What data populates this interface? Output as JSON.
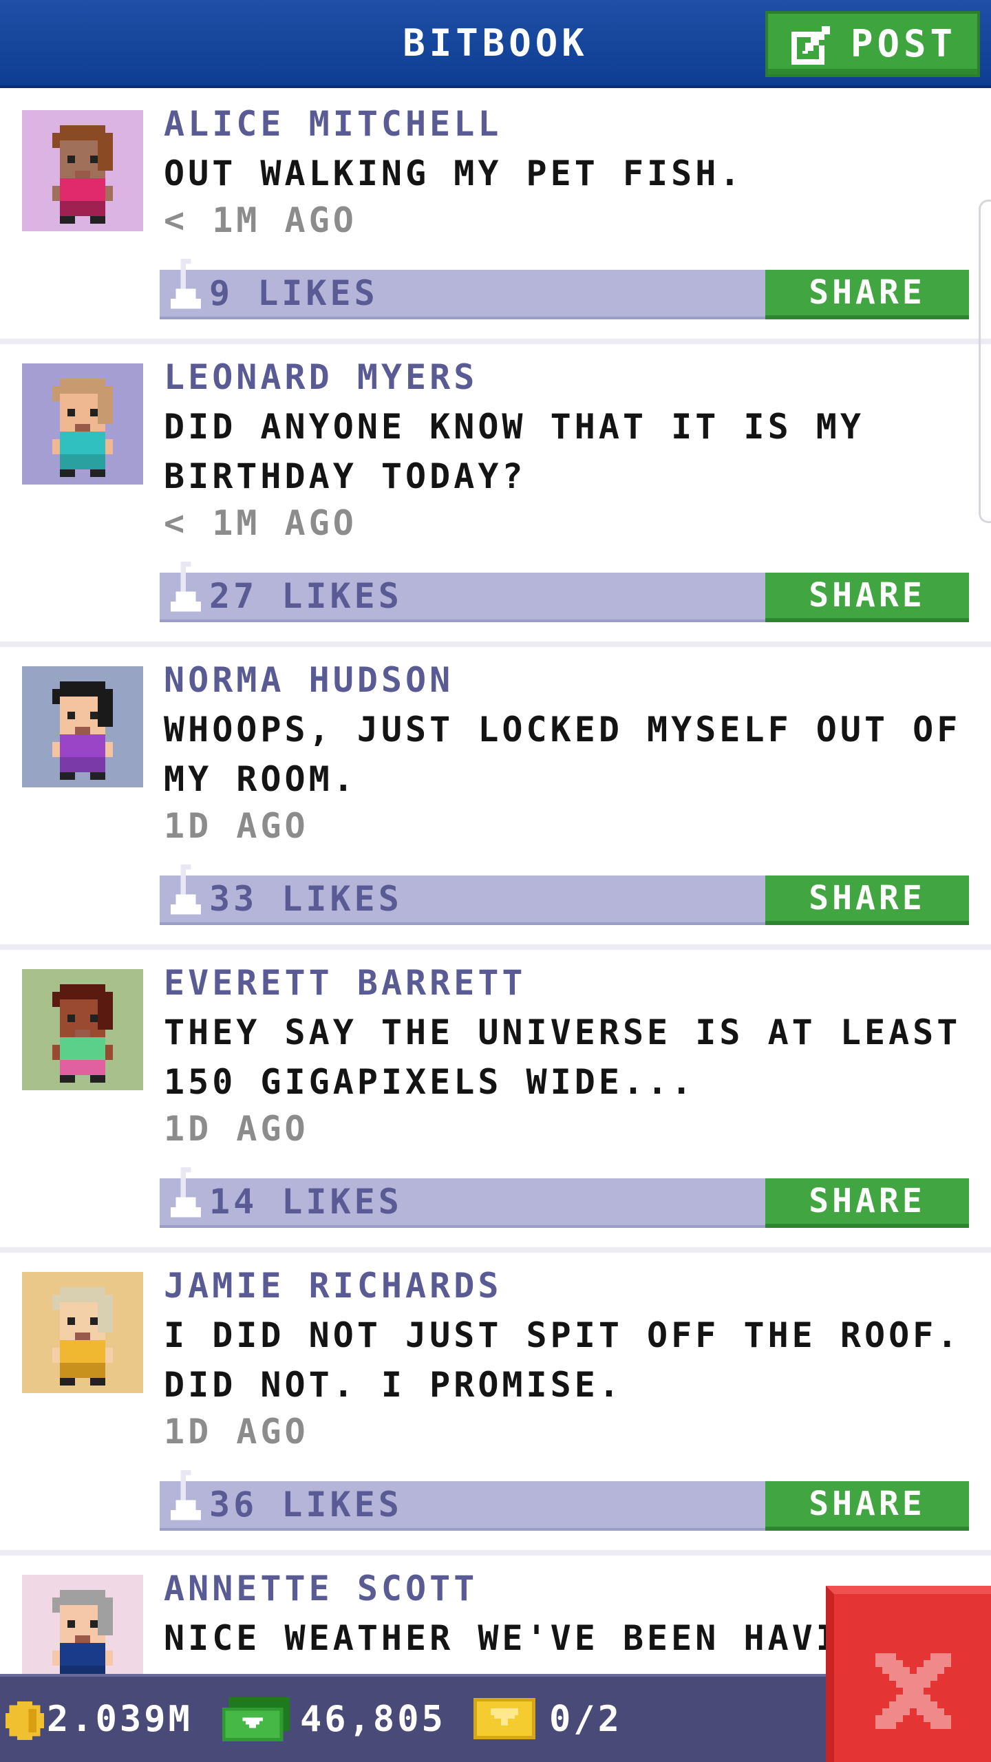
{
  "header": {
    "title": "BITBOOK",
    "post_label": "POST"
  },
  "posts": [
    {
      "author": "ALICE MITCHELL",
      "message": "OUT WALKING MY PET FISH.",
      "time": "< 1M AGO",
      "likes": "9 LIKES",
      "share_label": "SHARE",
      "avatar": {
        "bg": "#dcb4e4",
        "skin": "#a0705a",
        "hair": "#8a4a24",
        "shirt": "#e02a6c",
        "pants": "#a02052"
      }
    },
    {
      "author": "LEONARD MYERS",
      "message": "DID ANYONE KNOW THAT IT IS MY BIRTHDAY TODAY?",
      "time": "< 1M AGO",
      "likes": "27 LIKES",
      "share_label": "SHARE",
      "avatar": {
        "bg": "#a49ed2",
        "skin": "#f0b890",
        "hair": "#c89a70",
        "shirt": "#30c0c0",
        "pants": "#2aa0a0"
      }
    },
    {
      "author": "NORMA HUDSON",
      "message": "WHOOPS, JUST LOCKED MYSELF OUT OF MY ROOM.",
      "time": "1D AGO",
      "likes": "33 LIKES",
      "share_label": "SHARE",
      "avatar": {
        "bg": "#98a4c4",
        "skin": "#f4c4a0",
        "hair": "#1a1a1a",
        "shirt": "#9a44c8",
        "pants": "#7a3aa8"
      }
    },
    {
      "author": "EVERETT BARRETT",
      "message": "THEY SAY THE UNIVERSE IS AT LEAST 150 GIGAPIXELS WIDE...",
      "time": "1D AGO",
      "likes": "14 LIKES",
      "share_label": "SHARE",
      "avatar": {
        "bg": "#a8c08c",
        "skin": "#9a4a30",
        "hair": "#5a1a10",
        "shirt": "#5ad08a",
        "pants": "#e060a0"
      }
    },
    {
      "author": "JAMIE RICHARDS",
      "message": "I DID NOT JUST SPIT OFF THE ROOF. DID NOT. I PROMISE.",
      "time": "1D AGO",
      "likes": "36 LIKES",
      "share_label": "SHARE",
      "avatar": {
        "bg": "#eac88a",
        "skin": "#f4d0a8",
        "hair": "#d8d0b0",
        "shirt": "#f0b830",
        "pants": "#c8901c"
      }
    },
    {
      "author": "ANNETTE SCOTT",
      "message": "NICE WEATHER WE'VE BEEN HAVI",
      "time": "",
      "likes": "",
      "share_label": "",
      "avatar": {
        "bg": "#f0d8e4",
        "skin": "#f4c8a8",
        "hair": "#a0a0a0",
        "shirt": "#1a3a8a",
        "pants": "#14306e"
      }
    }
  ],
  "status_bar": {
    "coins": "2.039M",
    "bux": "46,805",
    "tickets": "0/2"
  },
  "icons": {
    "post": "compose-icon",
    "like": "thumb-up-icon",
    "coin": "coin-icon",
    "bux": "bux-icon",
    "ticket": "ticket-icon",
    "close": "close-icon"
  }
}
